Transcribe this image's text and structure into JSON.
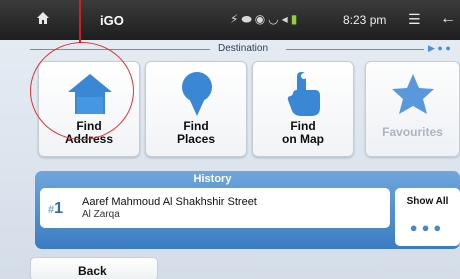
{
  "statusbar": {
    "app_name": "iGO",
    "time": "8:23 pm"
  },
  "destination": {
    "title": "Destination"
  },
  "tiles": [
    {
      "label": "Find Address",
      "icon": "house-icon"
    },
    {
      "label": "Find Places",
      "icon": "map-pin-icon"
    },
    {
      "label": "Find on Map",
      "icon": "hand-pointer-icon"
    },
    {
      "label": "Favourites",
      "icon": "star-icon",
      "disabled": true
    }
  ],
  "history": {
    "title": "History",
    "items": [
      {
        "number": "1",
        "street": "Aaref Mahmoud Al Shakhshir Street",
        "city": "Al Zarqa"
      }
    ],
    "show_all_label": "Show All"
  },
  "back_label": "Back",
  "colors": {
    "accent_blue": "#4a90d9",
    "status_bar": "#2a2a2a",
    "battery": "#8fd03c",
    "highlight_red": "#d33333",
    "disabled_text": "#a8b0ba"
  }
}
